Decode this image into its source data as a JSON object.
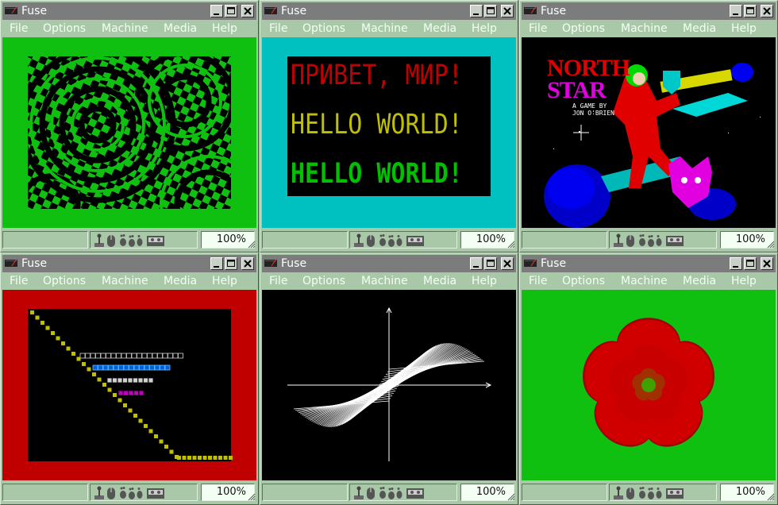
{
  "window_title": "Fuse",
  "menus": [
    "File",
    "Options",
    "Machine",
    "Media",
    "Help"
  ],
  "zoom": "100%",
  "windows": [
    {
      "id": "w1",
      "screen": "checker-pattern",
      "border_color": "#10c010"
    },
    {
      "id": "w2",
      "screen": "hello-world",
      "border_color": "#00c0c0",
      "lines": [
        "ПРИВЕТ, МИР!",
        "HELLO WORLD!",
        "HELLO WORLD!"
      ],
      "line_colors": [
        "#c00000",
        "#c0c000",
        "#00c000"
      ]
    },
    {
      "id": "w3",
      "screen": "north-star",
      "border_color": "#000000",
      "game_title_1": "NORTH",
      "game_title_2": "STAR",
      "byline_1": "A GAME BY",
      "byline_2": "JON O'BRIEN"
    },
    {
      "id": "w4",
      "screen": "block-stairs",
      "border_color": "#c00000"
    },
    {
      "id": "w5",
      "screen": "line-art",
      "border_color": "#000000"
    },
    {
      "id": "w6",
      "screen": "flower",
      "border_color": "#10c010"
    }
  ],
  "icons": [
    "zx-machine-icon",
    "joystick-icon",
    "mouse-icon",
    "footprints-icon",
    "tape-icon",
    "minimize-icon",
    "maximize-icon",
    "close-icon"
  ]
}
